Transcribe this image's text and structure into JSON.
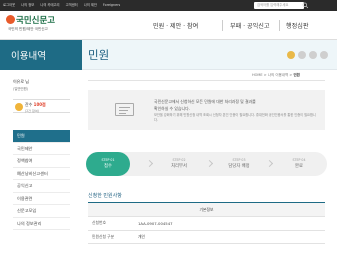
{
  "topbar": {
    "links": [
      "로그아웃",
      "나의 정보",
      "나의 카테고리",
      "고객센터",
      "나의 제안",
      "Foreigners"
    ],
    "search_placeholder": "검색어를 입력해주세요"
  },
  "logo": {
    "title": "국민신문고",
    "subtitle": "국민의 민원/제안 국민신고"
  },
  "nav": {
    "items": [
      "민원 · 제안 · 참여",
      "부패 · 공익신고",
      "행정심판"
    ]
  },
  "sidebar": {
    "title": "이용내역",
    "user_name": "이유로 님",
    "user_sub": "(일반민원)",
    "points_label": "잔수",
    "points_value": "100점",
    "points_sub": "(2건 참여)",
    "menu": [
      {
        "label": "민원",
        "active": true
      },
      {
        "label": "국민제안",
        "active": false
      },
      {
        "label": "정책참여",
        "active": false
      },
      {
        "label": "예산낭비신고센터",
        "active": false
      },
      {
        "label": "공익신고",
        "active": false
      },
      {
        "label": "이용관련",
        "active": false
      },
      {
        "label": "신문고모임",
        "active": false
      },
      {
        "label": "나의 정보관리",
        "active": false
      }
    ]
  },
  "page": {
    "title": "민원"
  },
  "breadcrumb": {
    "home": "HOME",
    "sep": ">",
    "parent": "나의 이용내역",
    "current": "민원"
  },
  "notice": {
    "line1": "국민신문고에서 신청하신 모든 민원에 대한 처리과정 및 결과를",
    "line2": "확인하실 수 있습니다.",
    "detail": "보안을 강화하기 위해 민원신청 내역 조회시 신청자 본인 인증이 필요합니다. 휴대전화 공인인증서를 통한 인증이 필요합니다."
  },
  "steps": [
    {
      "num": "STEP 01",
      "label": "접수"
    },
    {
      "num": "STEP 02",
      "label": "처리부서"
    },
    {
      "num": "STEP 03",
      "label": "담당자 배정"
    },
    {
      "num": "STEP 04",
      "label": "완료"
    }
  ],
  "section": {
    "title": "신청한 민원사항",
    "table_header": "기본정보",
    "rows": [
      {
        "key": "신청번호",
        "value": "1AA-0907-004547"
      },
      {
        "key": "민원신청 구분",
        "value": "개인"
      }
    ]
  },
  "colors": {
    "teal": "#1e6b85",
    "green": "#2eab8e",
    "orange": "#e85a2a"
  }
}
